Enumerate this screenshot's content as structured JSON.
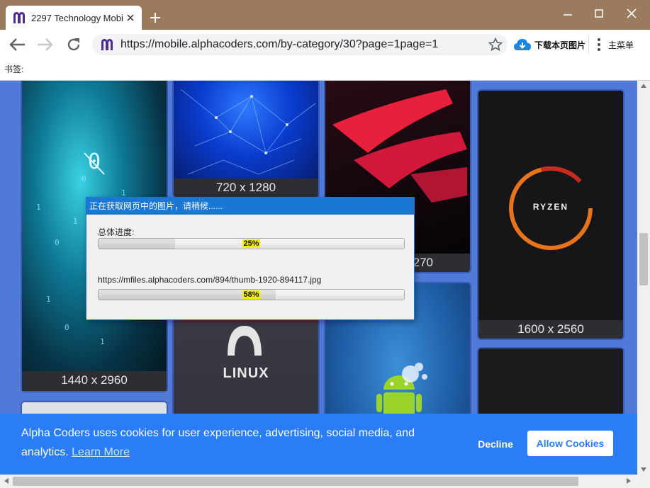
{
  "browser": {
    "tab_title": "2297 Technology Mobi",
    "url": "https://mobile.alphacoders.com/by-category/30?page=1page=1",
    "download_label": "下载本页图片",
    "menu_label": "主菜单",
    "bookmarks_label": "书签:"
  },
  "gallery": {
    "items": [
      {
        "resolution": "1440 x 2960"
      },
      {
        "resolution": "720 x 1280"
      },
      {
        "resolution": "270"
      },
      {
        "resolution": "1600 x 2560"
      }
    ],
    "logo_ryzen": "RYZEN",
    "logo_linux": "LINUX"
  },
  "cookie_banner": {
    "message": "Alpha Coders uses cookies for user experience, advertising, social media, and analytics.",
    "learn_more": "Learn More",
    "decline": "Decline",
    "allow": "Allow Cookies"
  },
  "progress_dialog": {
    "title": "正在获取网页中的图片，请稍候......",
    "overall_label": "总体进度:",
    "overall_percent": 25,
    "overall_text": "25%",
    "current_url": "https://mfiles.alphacoders.com/894/thumb-1920-894117.jpg",
    "current_percent": 58,
    "current_text": "58%"
  },
  "colors": {
    "page_bg": "#4f7ad8",
    "banner": "#2b7df5",
    "dialog_title": "#1a78d4",
    "percent_highlight": "#f4f000"
  }
}
